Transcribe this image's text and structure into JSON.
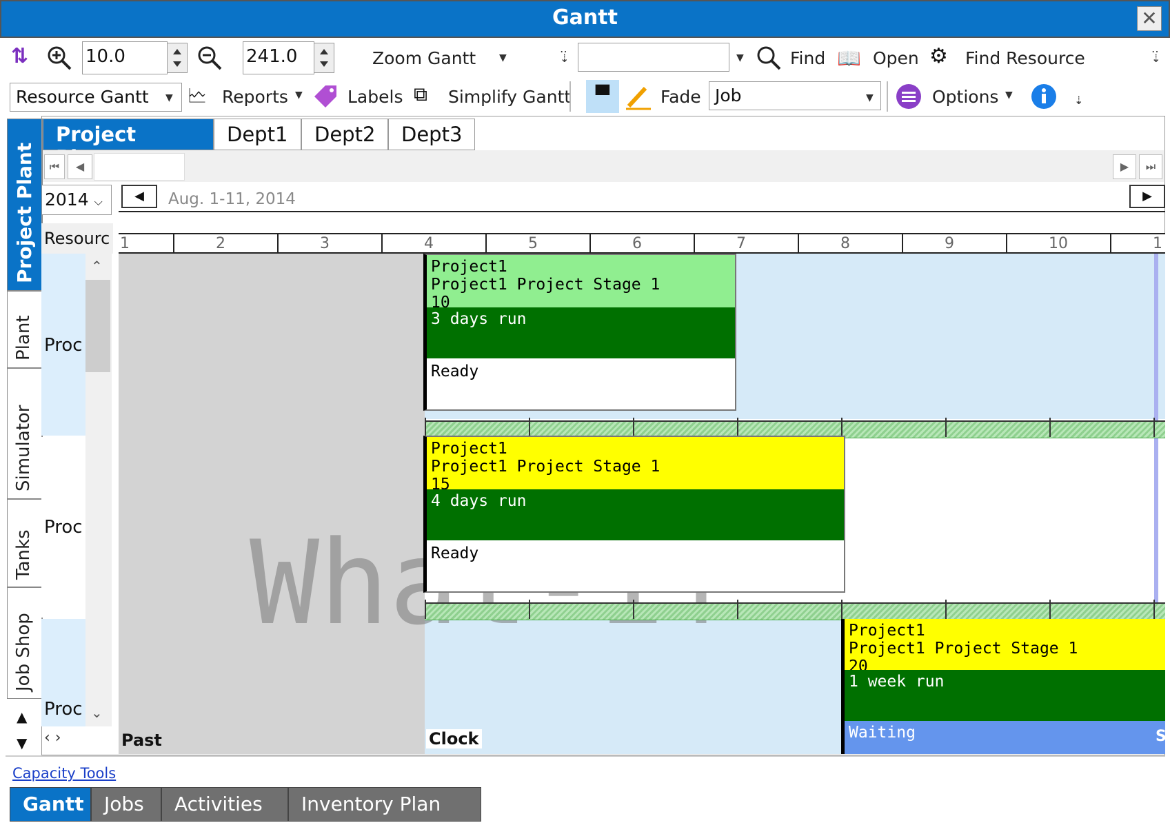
{
  "window": {
    "title": "Gantt",
    "close": "✕"
  },
  "toolbar1": {
    "zoom_in_value": "10.0",
    "zoom_out_value": "241.0",
    "zoom_gantt": "Zoom Gantt",
    "find": "Find",
    "open": "Open",
    "find_resource": "Find Resource"
  },
  "toolbar2": {
    "gantt_type": "Resource Gantt",
    "reports": "Reports",
    "labels": "Labels",
    "simplify": "Simplify Gantt",
    "fade": "Fade",
    "fade_value": "Job",
    "options": "Options"
  },
  "side_tabs": [
    "Project Plant",
    "Plant",
    "Simulator",
    "Tanks",
    "Job Shop"
  ],
  "tabs": [
    "Project Plant",
    "Dept1",
    "Dept2",
    "Dept3"
  ],
  "date": {
    "year": "2014",
    "range": "Aug. 1-11, 2014"
  },
  "resource_header": "Resourc",
  "ruler": [
    "1",
    "2",
    "3",
    "4",
    "5",
    "6",
    "7",
    "8",
    "9",
    "10",
    "1"
  ],
  "rows": [
    "Proc",
    "Proc",
    "Proc"
  ],
  "watermark": "What-If",
  "blocks": [
    {
      "job": "Project1",
      "stage": "Project1 Project Stage 1",
      "qty": "10",
      "run": "3 days run",
      "status": "Ready"
    },
    {
      "job": "Project1",
      "stage": "Project1 Project Stage 1",
      "qty": "15",
      "run": "4 days run",
      "status": "Ready"
    },
    {
      "job": "Project1",
      "stage": "Project1 Project Stage 1",
      "qty": "20",
      "run": "1 week run",
      "status": "Waiting"
    }
  ],
  "markers": {
    "past": "Past",
    "clock": "Clock",
    "edge": "S"
  },
  "footer": {
    "capacity_tools": "Capacity Tools"
  },
  "bottom_tabs": [
    "Gantt",
    "Jobs",
    "Activities",
    "Inventory Plan"
  ],
  "colors": {
    "title_bar": "#0a73c7",
    "block_green": "#90ee90",
    "block_yellow": "#ffff00",
    "run_green": "#007000",
    "waiting_blue": "#6495ed",
    "past_gray": "#d3d3d3",
    "lane_blue": "#d6eaf8"
  }
}
